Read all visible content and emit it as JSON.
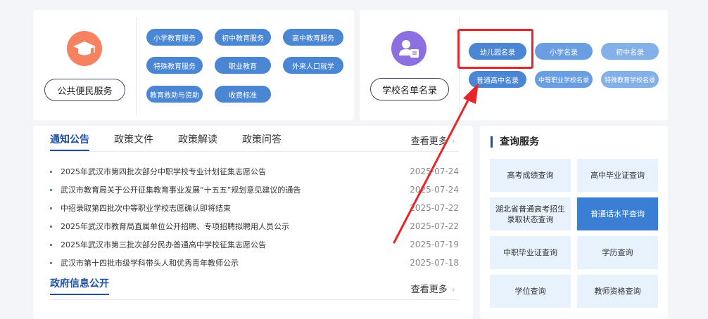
{
  "public_service": {
    "label": "公共便民服务",
    "icon": "graduation-cap-icon",
    "buttons": [
      "小学教育服务",
      "初中教育服务",
      "高中教育服务",
      "特殊教育服务",
      "职业教育",
      "外来人口就学",
      "教育救助与资助",
      "收费标准"
    ]
  },
  "school_list": {
    "label": "学校名单名录",
    "icon": "user-list-icon",
    "buttons": [
      "幼儿园名录",
      "小学名录",
      "初中名录",
      "普通高中名录",
      "中等职业学校名录",
      "特殊教育学校名录"
    ]
  },
  "notice": {
    "tabs": [
      "通知公告",
      "政策文件",
      "政策解读",
      "政策问答"
    ],
    "more": "查看更多",
    "items": [
      {
        "title": "2025年武汉市第四批次部分中职学校专业计划征集志愿公告",
        "date": "2025-07-24"
      },
      {
        "title": "武汉市教育局关于公开征集教育事业发展“十五五”规划意见建议的通告",
        "date": "2025-07-24"
      },
      {
        "title": "中招录取第四批次中等职业学校志愿确认即将结束",
        "date": "2025-07-22"
      },
      {
        "title": "2025年武汉市教育局直属单位公开招聘、专项招聘拟聘用人员公示",
        "date": "2025-07-22"
      },
      {
        "title": "2025年武汉市第三批次部分民办普通高中学校征集志愿公告",
        "date": "2025-07-19"
      },
      {
        "title": "武汉市第十四批市级学科带头人和优秀青年教师公示",
        "date": "2025-07-18"
      }
    ],
    "gov_title": "政府信息公开",
    "gov_more": "查看更多"
  },
  "query": {
    "title": "查询服务",
    "buttons": [
      "高考成绩查询",
      "高中毕业证查询",
      "湖北省普通高考招生录取状态查询",
      "普通话水平查询",
      "中职毕业证查询",
      "学历查询",
      "学位查询",
      "教师资格查询"
    ]
  },
  "colors": {
    "accent": "#1d4ea3",
    "pill": "#4a86d4",
    "annotation": "#e8262a"
  }
}
